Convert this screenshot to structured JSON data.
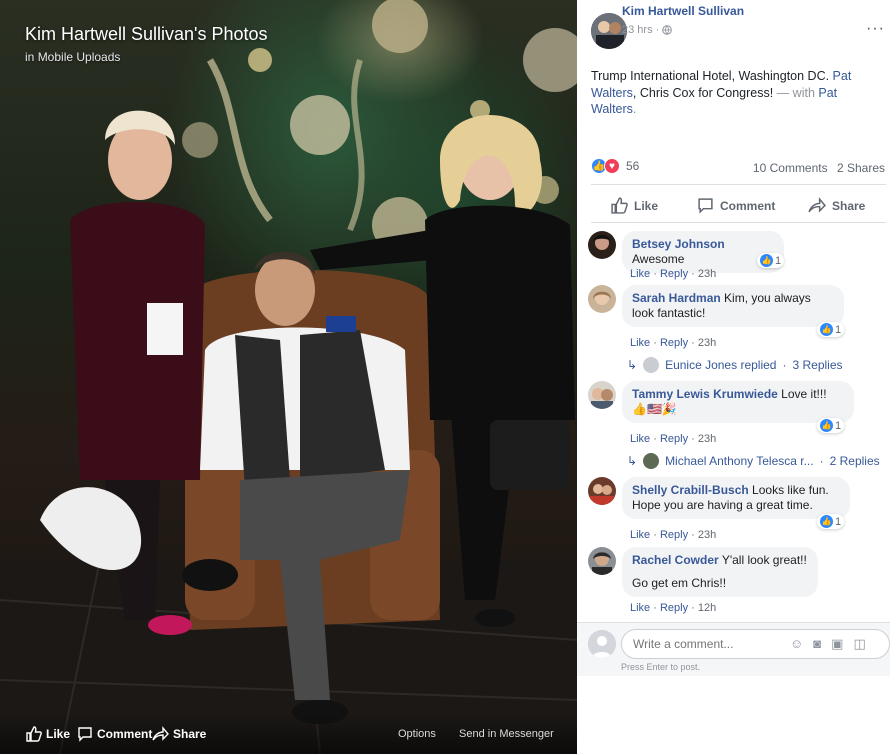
{
  "photo": {
    "title": "Kim Hartwell Sullivan's Photos",
    "subtitle_prefix": "in",
    "subtitle_album": "Mobile Uploads",
    "actions": {
      "like": "Like",
      "comment": "Comment",
      "share": "Share",
      "options": "Options",
      "send": "Send in Messenger"
    }
  },
  "post": {
    "author": "Kim Hartwell Sullivan",
    "time": "23 hrs",
    "privacy_icon": "globe-icon",
    "text_intro": "Trump International Hotel, Washington DC. ",
    "text_link1": "Pat Walters",
    "text_mid": ", Chris Cox for Congress!",
    "text_with": " — with ",
    "text_link2": "Pat Walters",
    "text_end": ".",
    "reaction_count": "56",
    "comments_count": "10 Comments",
    "shares_count": "2 Shares",
    "actions": {
      "like": "Like",
      "comment": "Comment",
      "share": "Share"
    }
  },
  "comments": [
    {
      "name": "Betsey Johnson",
      "text": "Awesome",
      "like": "Like",
      "reply": "Reply",
      "time": "23h",
      "reactions": "1"
    },
    {
      "name": "Sarah Hardman",
      "text": "Kim, you always look fantastic!",
      "like": "Like",
      "reply": "Reply",
      "time": "23h",
      "reactions": "1",
      "reply_preview": {
        "text": "Eunice Jones replied",
        "count": "3 Replies"
      }
    },
    {
      "name": "Tammy Lewis Krumwiede",
      "text": "Love it!!! 👍🇺🇸🎉",
      "like": "Like",
      "reply": "Reply",
      "time": "23h",
      "reactions": "1",
      "reply_preview": {
        "text": "Michael Anthony Telesca r...",
        "count": "2 Replies"
      }
    },
    {
      "name": "Shelly Crabill-Busch",
      "text": "Looks like fun. Hope you are having a great time.",
      "like": "Like",
      "reply": "Reply",
      "time": "23h",
      "reactions": "1"
    },
    {
      "name": "Rachel Cowder",
      "text": "Y'all look great!!",
      "text2": "Go get em Chris!!",
      "like": "Like",
      "reply": "Reply",
      "time": "12h"
    }
  ],
  "composer": {
    "placeholder": "Write a comment...",
    "hint": "Press Enter to post."
  },
  "colors": {
    "link": "#365899",
    "like_blue": "#2d88ff",
    "love_red": "#f33e58"
  }
}
